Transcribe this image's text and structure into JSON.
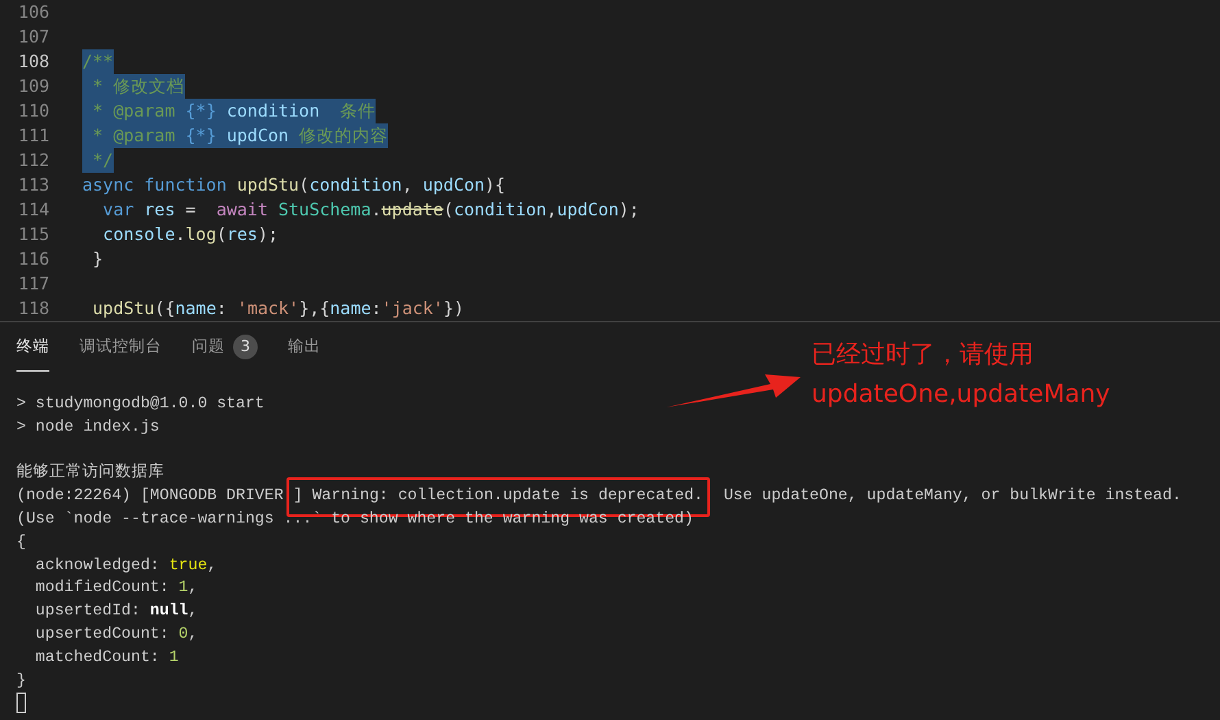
{
  "editor": {
    "lines": [
      {
        "number": "106",
        "current": false
      },
      {
        "number": "107",
        "current": false
      },
      {
        "number": "108",
        "current": true,
        "selected": true,
        "tokens": [
          {
            "kind": "comment",
            "text": "/**"
          }
        ]
      },
      {
        "number": "109",
        "current": false,
        "selected": true,
        "tokens": [
          {
            "kind": "comment",
            "text": " * 修改文档"
          }
        ]
      },
      {
        "number": "110",
        "current": false,
        "selected": true,
        "tokens": [
          {
            "kind": "comment",
            "text": " * @param "
          },
          {
            "kind": "type",
            "text": "{*}"
          },
          {
            "kind": "variable",
            "text": " condition "
          },
          {
            "kind": "comment",
            "text": " 条件"
          }
        ]
      },
      {
        "number": "111",
        "current": false,
        "selected": true,
        "tokens": [
          {
            "kind": "comment",
            "text": " * @param "
          },
          {
            "kind": "type",
            "text": "{*}"
          },
          {
            "kind": "variable",
            "text": " updCon"
          },
          {
            "kind": "comment",
            "text": " 修改的内容"
          }
        ]
      },
      {
        "number": "112",
        "current": false,
        "selected": true,
        "tokens": [
          {
            "kind": "comment",
            "text": " */"
          }
        ]
      },
      {
        "number": "113",
        "current": false,
        "selected": false,
        "tokens": [
          {
            "kind": "keyword",
            "text": "async function "
          },
          {
            "kind": "function",
            "text": "updStu"
          },
          {
            "kind": "punct",
            "text": "("
          },
          {
            "kind": "variable",
            "text": "condition"
          },
          {
            "kind": "punct",
            "text": ", "
          },
          {
            "kind": "variable",
            "text": "updCon"
          },
          {
            "kind": "punct",
            "text": "){"
          }
        ]
      },
      {
        "number": "114",
        "current": false,
        "selected": false,
        "tokens": [
          {
            "kind": "keyword",
            "text": "  var "
          },
          {
            "kind": "variable",
            "text": "res"
          },
          {
            "kind": "punct",
            "text": " =  "
          },
          {
            "kind": "control",
            "text": "await "
          },
          {
            "kind": "class",
            "text": "StuSchema"
          },
          {
            "kind": "punct",
            "text": "."
          },
          {
            "kind": "deprecated",
            "text": "update"
          },
          {
            "kind": "punct",
            "text": "("
          },
          {
            "kind": "variable",
            "text": "condition"
          },
          {
            "kind": "punct",
            "text": ","
          },
          {
            "kind": "variable",
            "text": "updCon"
          },
          {
            "kind": "punct",
            "text": ");"
          }
        ]
      },
      {
        "number": "115",
        "current": false,
        "selected": false,
        "tokens": [
          {
            "kind": "variable",
            "text": "  console"
          },
          {
            "kind": "punct",
            "text": "."
          },
          {
            "kind": "function",
            "text": "log"
          },
          {
            "kind": "punct",
            "text": "("
          },
          {
            "kind": "variable",
            "text": "res"
          },
          {
            "kind": "punct",
            "text": ");"
          }
        ]
      },
      {
        "number": "116",
        "current": false,
        "selected": false,
        "tokens": [
          {
            "kind": "punct",
            "text": " }"
          }
        ]
      },
      {
        "number": "117",
        "current": false
      },
      {
        "number": "118",
        "current": false,
        "selected": false,
        "tokens": [
          {
            "kind": "function",
            "text": " updStu"
          },
          {
            "kind": "punct",
            "text": "({"
          },
          {
            "kind": "variable",
            "text": "name"
          },
          {
            "kind": "punct",
            "text": ": "
          },
          {
            "kind": "string",
            "text": "'mack'"
          },
          {
            "kind": "punct",
            "text": "},{"
          },
          {
            "kind": "variable",
            "text": "name"
          },
          {
            "kind": "punct",
            "text": ":"
          },
          {
            "kind": "string",
            "text": "'jack'"
          },
          {
            "kind": "punct",
            "text": "})"
          }
        ]
      }
    ]
  },
  "panel": {
    "tabs": [
      {
        "label": "终端",
        "selected": true
      },
      {
        "label": "调试控制台",
        "selected": false
      },
      {
        "label": "问题",
        "selected": false,
        "badge": "3"
      },
      {
        "label": "输出",
        "selected": false
      }
    ],
    "terminal": {
      "cursor": true,
      "lines": [
        [
          {
            "kind": "plain",
            "text": "> studymongodb@1.0.0 start"
          }
        ],
        [
          {
            "kind": "plain",
            "text": "> node index.js"
          }
        ],
        [
          {
            "kind": "blank"
          }
        ],
        [
          {
            "kind": "plain",
            "text": "能够正常访问数据库"
          }
        ],
        [
          {
            "kind": "plain",
            "text": "(node:22264) [MONGODB DRIVER"
          },
          {
            "kind": "boxed",
            "text": "] Warning: collection.update is deprecated."
          },
          {
            "kind": "plain",
            "text": " Use updateOne, updateMany, or bulkWrite instead."
          }
        ],
        [
          {
            "kind": "plain",
            "text": "(Use `node --trace-warnings ...` to show where the warning was created)"
          }
        ],
        [
          {
            "kind": "plain",
            "text": "{"
          }
        ],
        [
          {
            "kind": "plain",
            "text": "  acknowledged: "
          },
          {
            "kind": "boolean",
            "text": "true"
          },
          {
            "kind": "plain",
            "text": ","
          }
        ],
        [
          {
            "kind": "plain",
            "text": "  modifiedCount: "
          },
          {
            "kind": "number",
            "text": "1"
          },
          {
            "kind": "plain",
            "text": ","
          }
        ],
        [
          {
            "kind": "plain",
            "text": "  upsertedId: "
          },
          {
            "kind": "null",
            "text": "null"
          },
          {
            "kind": "plain",
            "text": ","
          }
        ],
        [
          {
            "kind": "plain",
            "text": "  upsertedCount: "
          },
          {
            "kind": "number",
            "text": "0"
          },
          {
            "kind": "plain",
            "text": ","
          }
        ],
        [
          {
            "kind": "plain",
            "text": "  matchedCount: "
          },
          {
            "kind": "number",
            "text": "1"
          }
        ],
        [
          {
            "kind": "plain",
            "text": "}"
          }
        ]
      ]
    }
  },
  "annotation": {
    "lines": [
      "已经过时了，请使用",
      "updateOne,updateMany"
    ]
  }
}
